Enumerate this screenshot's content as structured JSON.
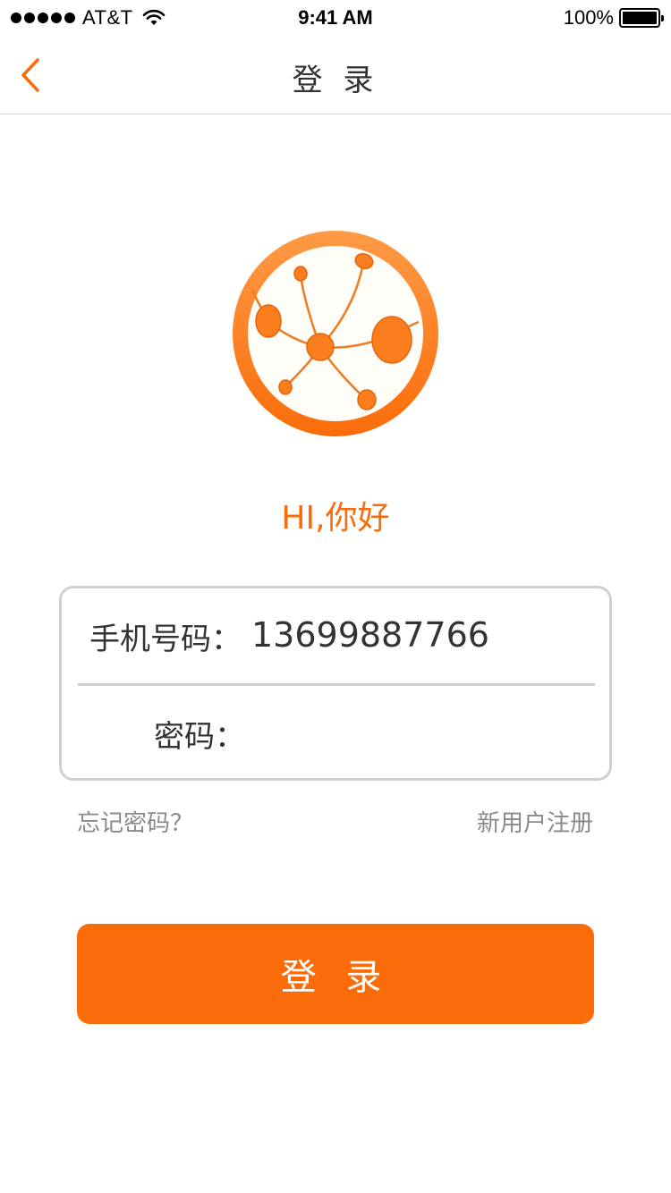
{
  "status_bar": {
    "carrier": "AT&T",
    "time": "9:41 AM",
    "battery_percent": "100%",
    "battery_level": 1.0
  },
  "nav": {
    "title": "登 录",
    "back_icon": "chevron-left-icon"
  },
  "logo": {
    "icon": "network-nodes-logo"
  },
  "greeting": "HI,你好",
  "form": {
    "phone_label": "手机号码：",
    "phone_value": "13699887766",
    "password_label": "密码：",
    "password_value": ""
  },
  "links": {
    "forgot_password": "忘记密码？",
    "register": "新用户注册"
  },
  "login_button": "登 录",
  "colors": {
    "accent": "#fa6c0a",
    "text": "#333333",
    "muted": "#8a8a8a",
    "border": "#d0d0d0"
  }
}
